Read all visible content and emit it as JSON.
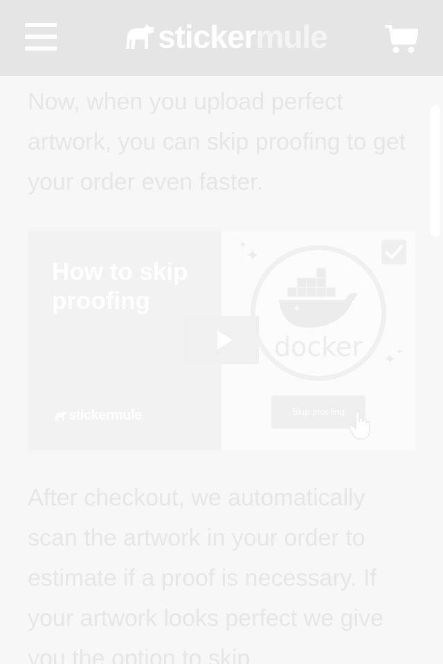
{
  "header": {
    "logo_part1": "sticker",
    "logo_part2": "mule",
    "menu_icon": "hamburger-menu-icon",
    "cart_icon": "shopping-cart-icon"
  },
  "content": {
    "paragraph1": "Now, when you upload perfect artwork, you can skip proofing to get your order even faster.",
    "paragraph2": "After checkout, we automatically scan the artwork in your order to estimate if a proof is necessary. If your artwork looks perfect we give you the option to skip"
  },
  "video": {
    "title": "How to skip proofing",
    "logo_part1": "sticker",
    "logo_part2": "mule",
    "docker_label": "docker",
    "skip_button_label": "Skip proofing",
    "play_icon": "play-icon",
    "checkbox_icon": "checkmark-icon",
    "cursor_icon": "hand-pointer-icon"
  },
  "colors": {
    "header_bg": "#e5e5e5",
    "page_bg": "#f7f7f7",
    "text": "#e6e6e6"
  }
}
